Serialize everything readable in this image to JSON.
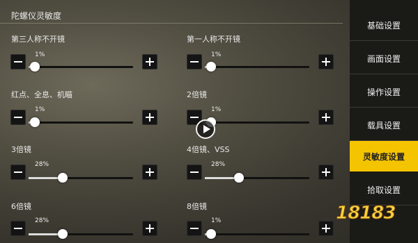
{
  "panel": {
    "title": "陀螺仪灵敏度"
  },
  "sliders": [
    {
      "label": "第三人称不开镜",
      "value_text": "1%",
      "level_percent": 1
    },
    {
      "label": "第一人称不开镜",
      "value_text": "1%",
      "level_percent": 1
    },
    {
      "label": "红点、全息、机瞄",
      "value_text": "1%",
      "level_percent": 1
    },
    {
      "label": "2倍镜",
      "value_text": "1%",
      "level_percent": 1
    },
    {
      "label": "3倍镜",
      "value_text": "28%",
      "level_percent": 28
    },
    {
      "label": "4倍镜、VSS",
      "value_text": "28%",
      "level_percent": 28
    },
    {
      "label": "6倍镜",
      "value_text": "28%",
      "level_percent": 28
    },
    {
      "label": "8倍镜",
      "value_text": "1%",
      "level_percent": 1
    }
  ],
  "menu": {
    "items": [
      {
        "label": "基础设置"
      },
      {
        "label": "画面设置"
      },
      {
        "label": "操作设置"
      },
      {
        "label": "载具设置"
      },
      {
        "label": "灵敏度设置"
      },
      {
        "label": "拾取设置"
      }
    ],
    "active_index": 4
  },
  "colors": {
    "accent": "#f5c400",
    "menu_bg": "#1a1a17",
    "button_bg": "#141414"
  },
  "watermark": {
    "text": "18183",
    "sub": ""
  }
}
